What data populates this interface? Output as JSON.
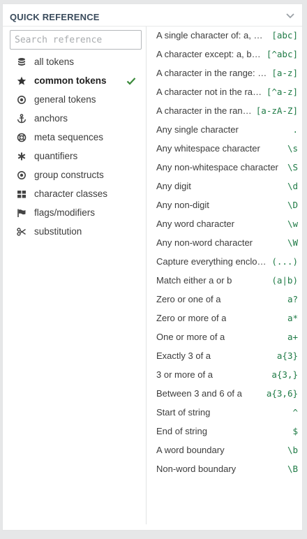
{
  "header": {
    "title": "QUICK REFERENCE"
  },
  "search": {
    "placeholder": "Search reference"
  },
  "categories": [
    {
      "label": "all tokens",
      "icon": "database-icon"
    },
    {
      "label": "common tokens",
      "icon": "star-icon",
      "active": true
    },
    {
      "label": "general tokens",
      "icon": "dot-circle-icon"
    },
    {
      "label": "anchors",
      "icon": "anchor-icon"
    },
    {
      "label": "meta sequences",
      "icon": "lifebuoy-icon"
    },
    {
      "label": "quantifiers",
      "icon": "asterisk-icon"
    },
    {
      "label": "group constructs",
      "icon": "dot-circle-icon"
    },
    {
      "label": "character classes",
      "icon": "grid-icon"
    },
    {
      "label": "flags/modifiers",
      "icon": "flag-icon"
    },
    {
      "label": "substitution",
      "icon": "scissors-icon"
    }
  ],
  "references": [
    {
      "desc": "A single character of: a, b or c",
      "token": "[abc]"
    },
    {
      "desc": "A character except: a, b or c",
      "token": "[^abc]"
    },
    {
      "desc": "A character in the range: a-z",
      "token": "[a-z]"
    },
    {
      "desc": "A character not in the range: a-z",
      "token": "[^a-z]"
    },
    {
      "desc": "A character in the range: a-z or A-Z",
      "token": "[a-zA-Z]"
    },
    {
      "desc": "Any single character",
      "token": "."
    },
    {
      "desc": "Any whitespace character",
      "token": "\\s"
    },
    {
      "desc": "Any non-whitespace character",
      "token": "\\S"
    },
    {
      "desc": "Any digit",
      "token": "\\d"
    },
    {
      "desc": "Any non-digit",
      "token": "\\D"
    },
    {
      "desc": "Any word character",
      "token": "\\w"
    },
    {
      "desc": "Any non-word character",
      "token": "\\W"
    },
    {
      "desc": "Capture everything enclosed",
      "token": "(...)"
    },
    {
      "desc": "Match either a or b",
      "token": "(a|b)"
    },
    {
      "desc": "Zero or one of a",
      "token": "a?"
    },
    {
      "desc": "Zero or more of a",
      "token": "a*"
    },
    {
      "desc": "One or more of a",
      "token": "a+"
    },
    {
      "desc": "Exactly 3 of a",
      "token": "a{3}"
    },
    {
      "desc": "3 or more of a",
      "token": "a{3,}"
    },
    {
      "desc": "Between 3 and 6 of a",
      "token": "a{3,6}"
    },
    {
      "desc": "Start of string",
      "token": "^"
    },
    {
      "desc": "End of string",
      "token": "$"
    },
    {
      "desc": "A word boundary",
      "token": "\\b"
    },
    {
      "desc": "Non-word boundary",
      "token": "\\B"
    }
  ],
  "colors": {
    "token": "#1e7a45",
    "check": "#3a8a3a",
    "title": "#3a4b5c"
  }
}
